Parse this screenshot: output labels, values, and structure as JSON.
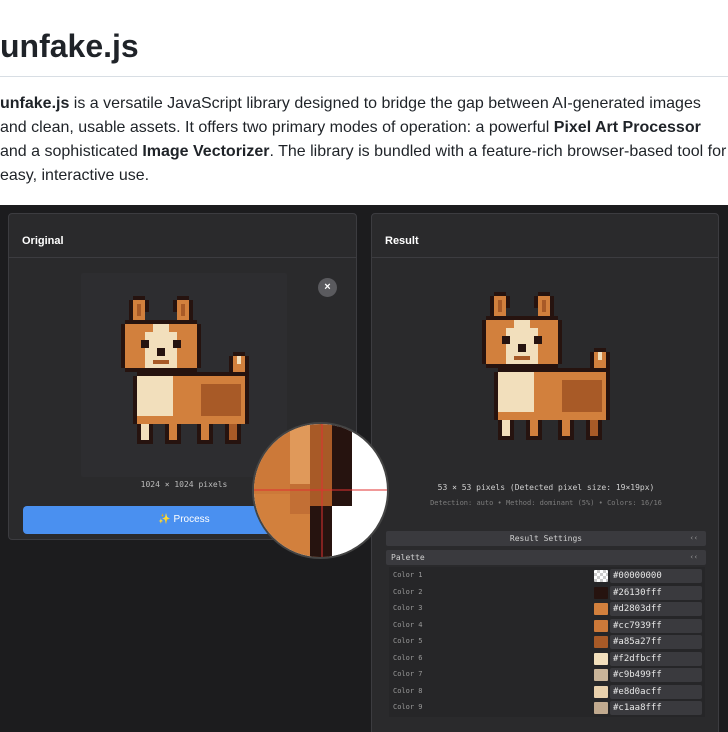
{
  "page": {
    "title": "unfake.js",
    "intro": {
      "lib_name": "unfake.js",
      "text1": " is a versatile JavaScript library designed to bridge the gap between AI-generated images and clean, usable assets. It offers two primary modes of operation: a powerful ",
      "mode1": "Pixel Art Processor",
      "text2": " and a sophisticated ",
      "mode2": "Image Vectorizer",
      "text3": ". The library is bundled with a feature-rich browser-based tool for easy, interactive use."
    }
  },
  "app": {
    "original": {
      "heading": "Original",
      "close_icon": "×",
      "dimensions": "1024 × 1024 pixels",
      "process_label": "✨ Process"
    },
    "result": {
      "heading": "Result",
      "dimensions": "53 × 53 pixels (Detected pixel size: 19×19px)",
      "meta": "Detection: auto • Method: dominant (5%) • Colors: 16/16",
      "settings_label": "Result Settings",
      "palette_label": "Palette",
      "chevron": "‹‹",
      "palette": [
        {
          "name": "Color 1",
          "hex": "#00000000",
          "swatch": "transparent"
        },
        {
          "name": "Color 2",
          "hex": "#26130fff",
          "swatch": "#26130f"
        },
        {
          "name": "Color 3",
          "hex": "#d2803dff",
          "swatch": "#d2803d"
        },
        {
          "name": "Color 4",
          "hex": "#cc7939ff",
          "swatch": "#cc7939"
        },
        {
          "name": "Color 5",
          "hex": "#a85a27ff",
          "swatch": "#a85a27"
        },
        {
          "name": "Color 6",
          "hex": "#f2dfbcff",
          "swatch": "#f2dfbc"
        },
        {
          "name": "Color 7",
          "hex": "#c9b499ff",
          "swatch": "#c9b499"
        },
        {
          "name": "Color 8",
          "hex": "#e8d0acff",
          "swatch": "#e8d0ac"
        },
        {
          "name": "Color 9",
          "hex": "#c1aa8fff",
          "swatch": "#c1aa8f"
        }
      ]
    }
  },
  "colors": {
    "accent": "#4a90f0",
    "corgi_outline": "#26130f",
    "corgi_fur": "#d2803d",
    "corgi_shade": "#a85a27",
    "corgi_cream": "#f2dfbc"
  }
}
